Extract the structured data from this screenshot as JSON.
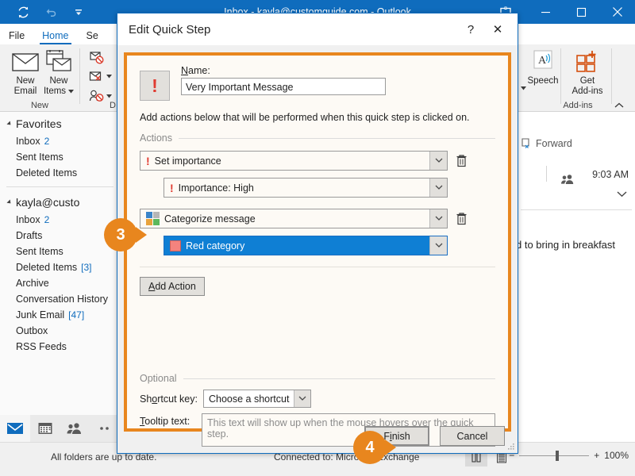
{
  "window": {
    "title": "Inbox - kayla@customguide.com - Outlook",
    "quick_access": [
      {
        "name": "send-receive-icon",
        "label": "Send/Receive All Folders"
      },
      {
        "name": "undo-icon",
        "label": "Undo"
      },
      {
        "name": "customize-quick-access-icon",
        "label": "Customize Quick Access Toolbar"
      }
    ],
    "touch_mode_label": "Touch/Mouse Mode",
    "controls": [
      {
        "name": "minimize-button",
        "glyph": "—"
      },
      {
        "name": "maximize-button",
        "glyph": "□"
      },
      {
        "name": "close-button",
        "glyph": "✕"
      }
    ]
  },
  "ribbon": {
    "tabs": [
      {
        "label": "File",
        "active": false
      },
      {
        "label": "Home",
        "active": true
      },
      {
        "label": "Se",
        "active": false
      }
    ],
    "groups": [
      {
        "label": "New",
        "buttons": [
          {
            "label_line1": "New",
            "label_line2": "Email",
            "icon": "new-email-icon"
          },
          {
            "label_line1": "New",
            "label_line2": "Items",
            "icon": "new-items-icon",
            "has_dropdown": true
          }
        ]
      },
      {
        "label": "Add-ins",
        "buttons": [
          {
            "label_line1": "Speech",
            "label_line2": "",
            "icon": "speech-icon",
            "has_dropdown": true
          },
          {
            "label_line1": "Get",
            "label_line2": "Add-ins",
            "icon": "get-addins-icon"
          }
        ]
      }
    ],
    "delete_group": {
      "label": "D",
      "items": [
        {
          "name": "ignore-icon"
        },
        {
          "name": "clean-up-icon",
          "has_dropdown": true
        },
        {
          "name": "junk-icon",
          "has_dropdown": true
        }
      ]
    },
    "collapse_label": "^"
  },
  "folder_pane": {
    "favorites": {
      "header": "Favorites",
      "items": [
        {
          "label": "Inbox",
          "count": "2"
        },
        {
          "label": "Sent Items",
          "count": ""
        },
        {
          "label": "Deleted Items",
          "count": ""
        }
      ]
    },
    "account": {
      "header": "kayla@custo",
      "items": [
        {
          "label": "Inbox",
          "count": "2"
        },
        {
          "label": "Drafts",
          "count": ""
        },
        {
          "label": "Sent Items",
          "count": ""
        },
        {
          "label": "Deleted Items",
          "count": "[3]"
        },
        {
          "label": "Archive",
          "count": ""
        },
        {
          "label": "Conversation History",
          "count": ""
        },
        {
          "label": "Junk Email",
          "count": "[47]"
        },
        {
          "label": "Outbox",
          "count": ""
        },
        {
          "label": "RSS Feeds",
          "count": ""
        }
      ]
    }
  },
  "nav_bar": {
    "items": [
      {
        "name": "mail-icon",
        "active": true
      },
      {
        "name": "calendar-icon",
        "active": false
      },
      {
        "name": "people-icon",
        "active": false
      },
      {
        "name": "more-icon",
        "active": false
      }
    ]
  },
  "reading_pane": {
    "forward_label": "Forward",
    "time": "9:03 AM",
    "body_text": "d to bring in breakfast"
  },
  "status_bar": {
    "left": "All folders are up to date.",
    "middle": "Connected to: Microsoft Exchange",
    "zoom": "100%",
    "zoom_out": "−",
    "zoom_in": "+",
    "views": [
      {
        "name": "reading-view-icon",
        "active": true
      },
      {
        "name": "normal-view-icon",
        "active": false
      }
    ]
  },
  "dialog": {
    "title": "Edit Quick Step",
    "help_glyph": "?",
    "close_glyph": "✕",
    "icon_glyph": "!",
    "name_label_pre": "N",
    "name_label_post": "ame:",
    "name_value": "Very Important Message",
    "hint": "Add actions below that will be performed when this quick step is clicked on.",
    "actions_legend": "Actions",
    "actions": [
      {
        "label": "Set importance",
        "icon": "importance-icon",
        "deletable": true,
        "sub": {
          "label": "Importance: High",
          "icon": "importance-icon",
          "selected": false
        }
      },
      {
        "label": "Categorize message",
        "icon": "categorize-icon",
        "deletable": true,
        "sub": {
          "label": "Red category",
          "icon": "red-category-swatch",
          "selected": true
        }
      }
    ],
    "add_action_pre": "A",
    "add_action_post": "dd Action",
    "optional_legend": "Optional",
    "shortcut_label_pre": "Sh",
    "shortcut_label_mid": "o",
    "shortcut_label_post": "rtcut key:",
    "shortcut_value": "Choose a shortcut",
    "tooltip_label_pre": "T",
    "tooltip_label_post": "ooltip text:",
    "tooltip_placeholder": "This text will show up when the mouse hovers over the quick step.",
    "finish_label_pre": "F",
    "finish_label_mid": "i",
    "finish_label_post": "nish",
    "cancel_label": "Cancel"
  },
  "callouts": [
    {
      "number": "3"
    },
    {
      "number": "4"
    }
  ],
  "colors": {
    "accent_orange": "#e8861e",
    "outlook_blue": "#0f6cbd",
    "selection_blue": "#0f7fd4",
    "importance_red": "#e03b31",
    "red_category": "#f4837e"
  }
}
